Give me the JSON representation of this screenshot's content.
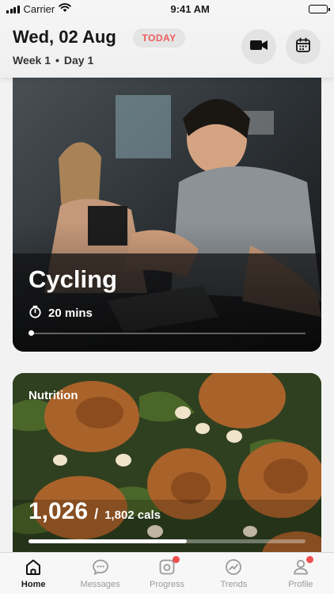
{
  "status_bar": {
    "carrier": "Carrier",
    "time": "9:41 AM"
  },
  "header": {
    "date": "Wed, 02 Aug",
    "today_badge": "TODAY",
    "week": "Week 1",
    "separator": "•",
    "day": "Day 1",
    "video_icon": "video-camera-icon",
    "calendar_icon": "calendar-icon"
  },
  "workout": {
    "title": "Cycling",
    "duration": "20 mins",
    "progress_fraction": 0.0
  },
  "nutrition": {
    "label": "Nutrition",
    "calories": "1,026",
    "slash": "/",
    "calorie_goal": "1,802 cals",
    "progress_fraction": 0.57
  },
  "tabs": [
    {
      "label": "Home",
      "icon": "home-icon",
      "active": true,
      "notification": false
    },
    {
      "label": "Messages",
      "icon": "chat-bubble-icon",
      "active": false,
      "notification": false
    },
    {
      "label": "Progress",
      "icon": "camera-icon",
      "active": false,
      "notification": true
    },
    {
      "label": "Trends",
      "icon": "trend-icon",
      "active": false,
      "notification": false
    },
    {
      "label": "Profile",
      "icon": "person-icon",
      "active": false,
      "notification": true
    }
  ],
  "colors": {
    "accent_red": "#ef5b5b",
    "notification_red": "#ef4f4f",
    "header_bg": "#f4f4f4"
  }
}
